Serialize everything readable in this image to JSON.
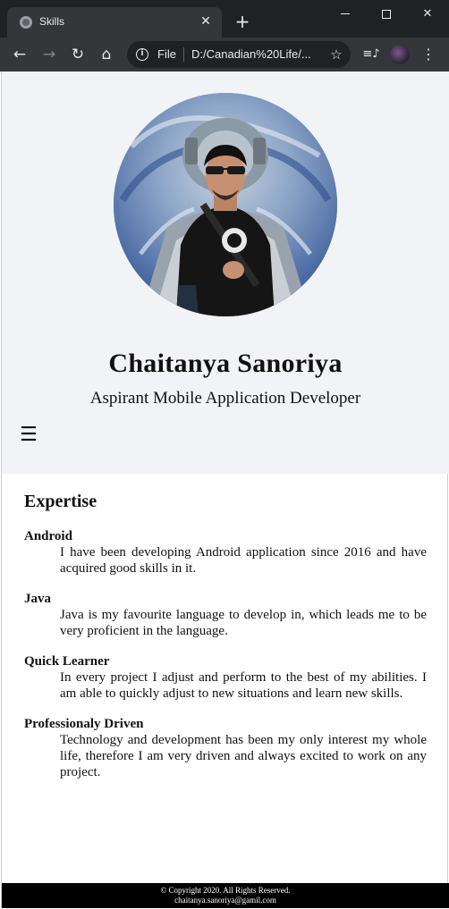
{
  "browser": {
    "tab_title": "Skills",
    "scheme_label": "File",
    "url": "D:/Canadian%20Life/...",
    "tab_close_glyph": "✕",
    "new_tab_glyph": "+",
    "icons": {
      "back": "back-arrow-icon",
      "forward": "forward-arrow-icon",
      "reload": "reload-icon",
      "home": "home-icon",
      "info": "info-icon",
      "bookmark": "star-icon",
      "media": "media-control-icon",
      "menu": "three-dot-menu-icon"
    }
  },
  "profile": {
    "name": "Chaitanya Sanoriya",
    "tagline": "Aspirant Mobile Application Developer",
    "menu_glyph": "☰"
  },
  "expertise": {
    "title": "Expertise",
    "skills": [
      {
        "name": "Android",
        "description": "I have been developing Android application since 2016 and have acquired good skills in it."
      },
      {
        "name": "Java",
        "description": "Java is my favourite language to develop in, which leads me to be very proficient in the language."
      },
      {
        "name": "Quick Learner",
        "description": "In every project I adjust and perform to the best of my abilities. I am able to quickly adjust to new situations and learn new skills."
      },
      {
        "name": "Professionaly Driven",
        "description": "Technology and development has been my only interest my whole life, therefore I am very driven and always excited to work on any project."
      }
    ]
  },
  "footer": {
    "copyright": "© Copyright 2020. All Rights Reserved.",
    "email": "chaitanya.sanoriya@gamil.com"
  },
  "colors": {
    "chrome_dark": "#202124",
    "chrome_toolbar": "#35363a",
    "hero_bg": "#f2f3f6",
    "footer_bg": "#000000"
  }
}
